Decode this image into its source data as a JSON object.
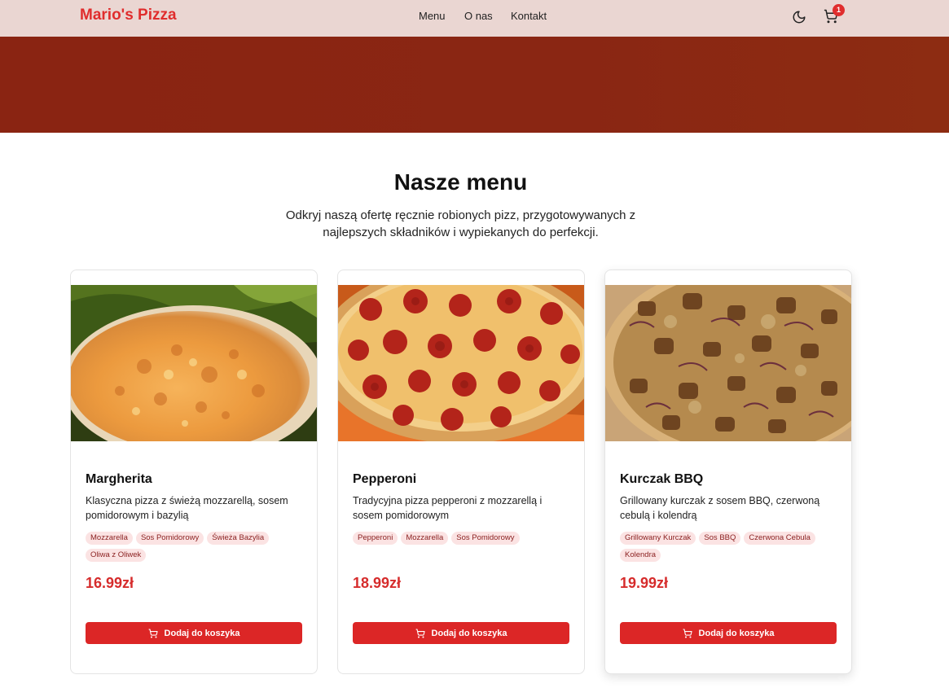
{
  "header": {
    "logo": "Mario's Pizza",
    "nav": [
      "Menu",
      "O nas",
      "Kontakt"
    ],
    "theme_icon": "moon-icon",
    "cart_icon": "cart-icon",
    "cart_count": "1",
    "colors": {
      "brand": "#e02d2d",
      "header_bg": "#ead6d2"
    }
  },
  "hero": {
    "color": "#8a2412"
  },
  "menu": {
    "title": "Nasze menu",
    "subtitle": "Odkryj naszą ofertę ręcznie robionych pizz, przygotowywanych z najlepszych składników i wypiekanych do perfekcji.",
    "items": [
      {
        "name": "Margherita",
        "description": "Klasyczna pizza z świeżą mozzarellą, sosem pomidorowym i bazylią",
        "tags": [
          "Mozzarella",
          "Sos Pomidorowy",
          "Świeża Bazylia",
          "Oliwa z Oliwek"
        ],
        "price": "16.99zł",
        "button": "Dodaj do koszyka"
      },
      {
        "name": "Pepperoni",
        "description": "Tradycyjna pizza pepperoni z mozzarellą i sosem pomidorowym",
        "tags": [
          "Pepperoni",
          "Mozzarella",
          "Sos Pomidorowy"
        ],
        "price": "18.99zł",
        "button": "Dodaj do koszyka"
      },
      {
        "name": "Kurczak BBQ",
        "description": "Grillowany kurczak z sosem BBQ, czerwoną cebulą i kolendrą",
        "tags": [
          "Grillowany Kurczak",
          "Sos BBQ",
          "Czerwona Cebula",
          "Kolendra"
        ],
        "price": "19.99zł",
        "button": "Dodaj do koszyka"
      }
    ],
    "colors": {
      "price": "#d62c2c",
      "button": "#dc2626",
      "tag_bg": "#fbe3e3"
    }
  }
}
